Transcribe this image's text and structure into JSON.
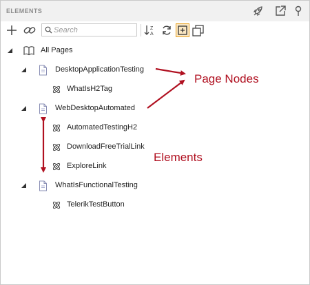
{
  "panel": {
    "title": "ELEMENTS",
    "header_icons": [
      "rocket-icon",
      "popout-icon",
      "pin-icon"
    ]
  },
  "toolbar": {
    "add_label": "add",
    "search_placeholder": "Search",
    "search_value": "",
    "icons": [
      "plus-icon",
      "link-icon",
      "search-icon",
      "sort-az-icon",
      "refresh-icon",
      "expand-all-icon",
      "collapse-all-icon"
    ],
    "expand_all_active": true,
    "accent_color": "#e8a020"
  },
  "tree": {
    "root": {
      "label": "All Pages",
      "expanded": true
    },
    "pages": [
      {
        "label": "DesktopApplicationTesting",
        "expanded": true,
        "elements": [
          "WhatIsH2Tag"
        ]
      },
      {
        "label": "WebDesktopAutomated",
        "expanded": true,
        "elements": [
          "AutomatedTestingH2",
          "DownloadFreeTrialLink",
          "ExploreLink"
        ]
      },
      {
        "label": "WhatIsFunctionalTesting",
        "expanded": true,
        "elements": [
          "TelerikTestButton"
        ]
      }
    ]
  },
  "annotations": {
    "page_nodes": "Page Nodes",
    "elements": "Elements",
    "color": "#b01020"
  }
}
